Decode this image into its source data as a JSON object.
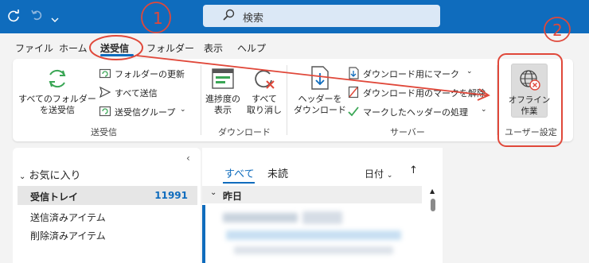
{
  "titlebar": {
    "search_placeholder": "検索",
    "icons": [
      "sync-icon",
      "undo-icon",
      "customize-qat-icon",
      "search-icon"
    ]
  },
  "tabs": [
    {
      "label": "ファイル",
      "active": false
    },
    {
      "label": "ホーム",
      "active": false
    },
    {
      "label": "送受信",
      "active": true
    },
    {
      "label": "フォルダー",
      "active": false
    },
    {
      "label": "表示",
      "active": false
    },
    {
      "label": "ヘルプ",
      "active": false
    }
  ],
  "ribbon": {
    "group_sendreceive": {
      "label": "送受信",
      "send_all_folders": [
        "すべてのフォルダー",
        "を送受信"
      ],
      "update_folder": "フォルダーの更新",
      "send_all": "すべて送信",
      "sendreceive_groups": "送受信グループ"
    },
    "group_download": {
      "label": "ダウンロード",
      "show_progress": [
        "進捗度の",
        "表示"
      ],
      "cancel_all": [
        "すべて",
        "取り消し"
      ]
    },
    "group_server": {
      "label": "サーバー",
      "download_headers": [
        "ヘッダーを",
        "ダウンロード"
      ],
      "mark_download": "ダウンロード用にマーク",
      "unmark_download": "ダウンロード用のマークを解除",
      "process_marked": "マークしたヘッダーの処理"
    },
    "group_preferences": {
      "label": "ユーザー設定",
      "work_offline": [
        "オフライン",
        "作業"
      ]
    }
  },
  "folder_pane": {
    "favorites_label": "お気に入り",
    "folders": [
      {
        "name": "受信トレイ",
        "count": "11991",
        "selected": true
      },
      {
        "name": "送信済みアイテム",
        "count": "",
        "selected": false
      },
      {
        "name": "削除済みアイテム",
        "count": "",
        "selected": false
      }
    ]
  },
  "message_list": {
    "filter_all": "すべて",
    "filter_unread": "未読",
    "sort_label": "日付",
    "group_yesterday": "昨日"
  },
  "annotations": {
    "mark_1": "1",
    "mark_2": "2",
    "color": "#e0483a"
  },
  "colors": {
    "accent": "#0f6cbd",
    "count": "#0f6cbd",
    "annotation": "#e0483a"
  }
}
